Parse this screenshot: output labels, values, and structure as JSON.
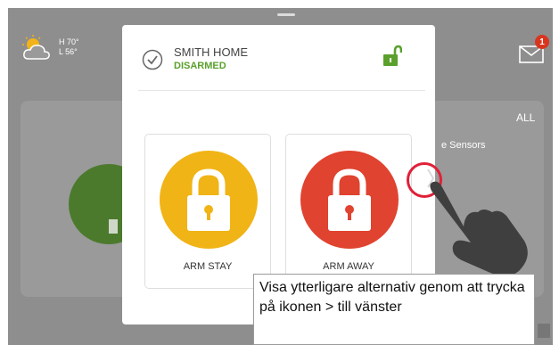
{
  "weather": {
    "icon": "partly-cloudy-icon",
    "high": "H 70°",
    "low": "L 56°"
  },
  "mail": {
    "icon": "envelope-icon",
    "badge_count": "1"
  },
  "background": {
    "filter_label": "ALL",
    "sensors_label": "e Sensors"
  },
  "modal": {
    "home_name": "SMITH HOME",
    "status": "DISARMED",
    "status_icon": "check-circle-icon",
    "lock_icon": "unlocked-padlock-icon",
    "arm_stay": {
      "label": "ARM STAY",
      "color": "#f1b416",
      "icon": "padlock-icon"
    },
    "arm_away": {
      "label": "ARM AWAY",
      "color": "#e0432f",
      "icon": "padlock-icon"
    }
  },
  "more_options": {
    "icon": "chevron-right-icon"
  },
  "hand_icon": "pointing-hand-icon",
  "caption": "Visa ytterligare alternativ genom att trycka på ikonen > till vänster",
  "colors": {
    "screen_bg": "#8e8e8e",
    "status_green": "#5aa02c",
    "highlight_red": "#e02038"
  }
}
